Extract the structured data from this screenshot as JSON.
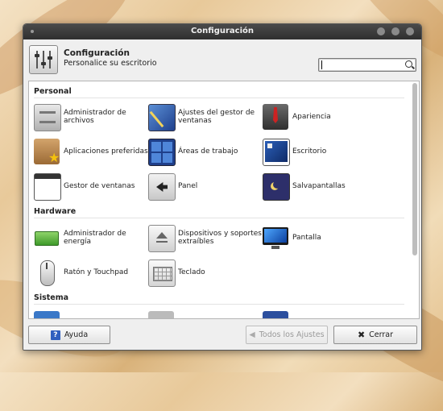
{
  "window": {
    "title": "Configuración"
  },
  "header": {
    "title": "Configuración",
    "subtitle": "Personalice su escritorio"
  },
  "search": {
    "value": "",
    "placeholder": ""
  },
  "sections": {
    "personal": "Personal",
    "hardware": "Hardware",
    "sistema": "Sistema"
  },
  "items": {
    "file_manager": "Administrador de archivos",
    "wm_tweaks": "Ajustes del gestor de ventanas",
    "appearance": "Apariencia",
    "preferred_apps": "Aplicaciones preferidas",
    "workspaces": "Áreas de trabajo",
    "desktop": "Escritorio",
    "window_manager": "Gestor de ventanas",
    "panel": "Panel",
    "screensaver": "Salvapantallas",
    "power_manager": "Administrador de energía",
    "removable_devices": "Dispositivos y soportes extraíbles",
    "display": "Pantalla",
    "mouse": "Ratón y Touchpad",
    "keyboard": "Teclado"
  },
  "footer": {
    "help": "Ayuda",
    "all_settings": "Todos los Ajustes",
    "close": "Cerrar"
  }
}
